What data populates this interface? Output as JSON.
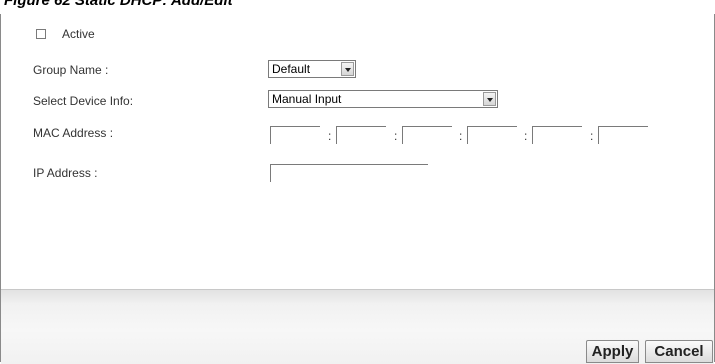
{
  "figure": {
    "title": "Figure 62   Static DHCP: Add/Edit"
  },
  "form": {
    "active_label": "Active",
    "active_checked": false,
    "group_name_label": "Group Name :",
    "group_name_value": "Default",
    "select_device_label": "Select Device Info:",
    "select_device_value": "Manual Input",
    "mac_label": "MAC Address :",
    "mac_fields": [
      "",
      "",
      "",
      "",
      "",
      ""
    ],
    "mac_separator": ":",
    "ip_label": "IP Address :",
    "ip_value": ""
  },
  "buttons": {
    "apply": "Apply",
    "cancel": "Cancel"
  }
}
